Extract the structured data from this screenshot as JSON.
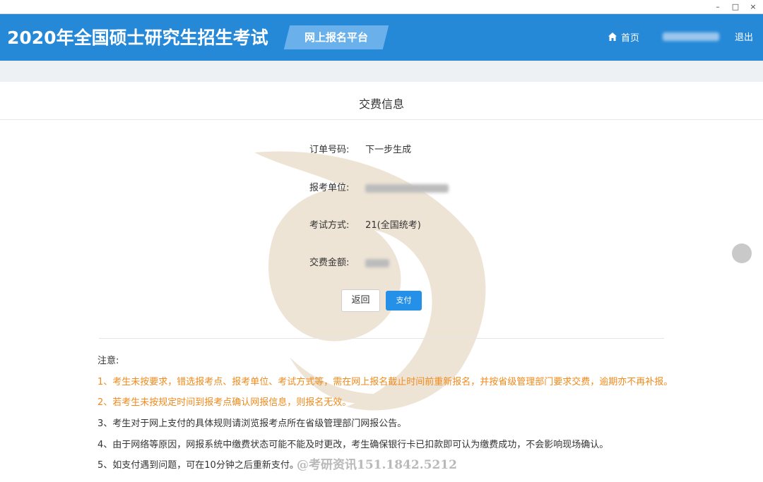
{
  "window": {
    "min": "–",
    "max": "□",
    "close": "×"
  },
  "header": {
    "title": "2020年全国硕士研究生招生考试",
    "platform": "网上报名平台",
    "home": "首页",
    "logout": "退出",
    "accent": "#2589d8"
  },
  "card": {
    "title": "交费信息",
    "fields": [
      {
        "label": "订单号码:",
        "value": "下一步生成"
      },
      {
        "label": "报考单位:",
        "value": ""
      },
      {
        "label": "考试方式:",
        "value": "21(全国统考)"
      },
      {
        "label": "交费金额:",
        "value": ""
      }
    ],
    "back_label": "返回",
    "pay_label": "支付"
  },
  "notes": {
    "title": "注意:",
    "items": [
      "1、考生未按要求，错选报考点、报考单位、考试方式等，需在网上报名截止时间前重新报名，并按省级管理部门要求交费，逾期亦不再补报。",
      "2、若考生未按规定时间到报考点确认网报信息，则报名无效。",
      "3、考生对于网上支付的具体规则请浏览报考点所在省级管理部门网报公告。",
      "4、由于网络等原因，网报系统中缴费状态可能不能及时更改，考生确保银行卡已扣款即可认为缴费成功，不会影响现场确认。",
      "5、如支付遇到问题，可在10分钟之后重新支付。"
    ],
    "promo": "@考研资讯151.1842.5212"
  }
}
